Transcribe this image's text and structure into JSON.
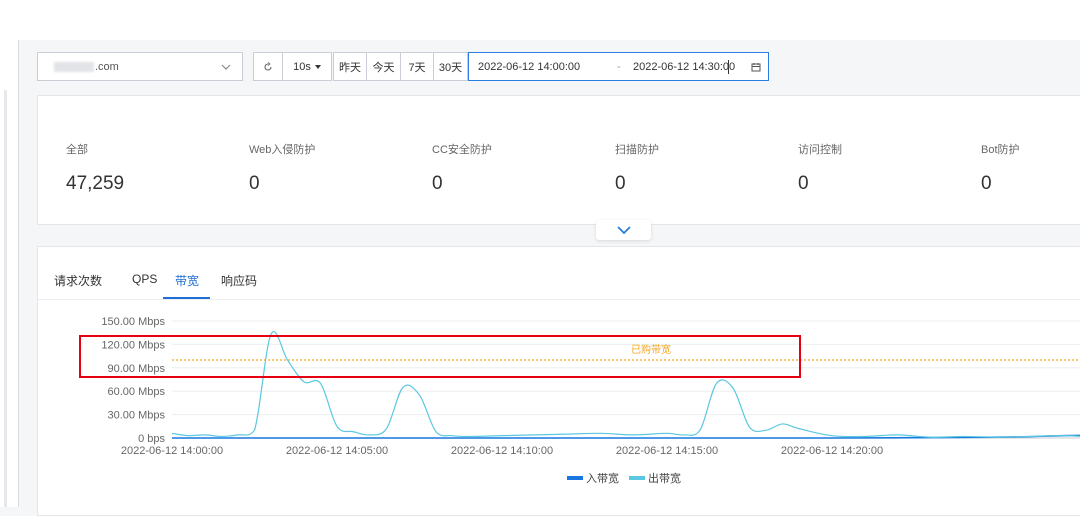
{
  "toolbar": {
    "domain_value": ".com",
    "refresh_interval": "10s",
    "ranges": [
      "昨天",
      "今天",
      "7天",
      "30天"
    ],
    "date_start": "2022-06-12 14:00:00",
    "date_separator": "-",
    "date_end": "2022-06-12 14:30:00"
  },
  "summary": {
    "stats": [
      {
        "label": "全部",
        "value": "47,259"
      },
      {
        "label": "Web入侵防护",
        "value": "0"
      },
      {
        "label": "CC安全防护",
        "value": "0"
      },
      {
        "label": "扫描防护",
        "value": "0"
      },
      {
        "label": "访问控制",
        "value": "0"
      },
      {
        "label": "Bot防护",
        "value": "0"
      }
    ]
  },
  "tabs": [
    "请求次数",
    "QPS",
    "带宽",
    "响应码"
  ],
  "active_tab": "带宽",
  "colors": {
    "accent": "#1f6fd4",
    "inbound": "#1677e0",
    "outbound": "#5bc8e0",
    "purchased_line": "#f5a623",
    "highlight_box": "#e60012"
  },
  "chart_data": {
    "type": "line",
    "y_ticks": [
      "150.00 Mbps",
      "120.00 Mbps",
      "90.00 Mbps",
      "60.00 Mbps",
      "30.00 Mbps",
      "0 bps"
    ],
    "ylim": [
      0,
      150
    ],
    "y_unit": "Mbps",
    "x_ticks": [
      "2022-06-12 14:00:00",
      "2022-06-12 14:05:00",
      "2022-06-12 14:10:00",
      "2022-06-12 14:15:00",
      "2022-06-12 14:20:00"
    ],
    "threshold": {
      "label": "已购带宽",
      "value": 100
    },
    "series": [
      {
        "name": "入带宽",
        "x": [
          "14:00:00",
          "14:02:00",
          "14:05:00",
          "14:10:00",
          "14:15:00",
          "14:20:00",
          "14:25:00",
          "14:27:00",
          "14:29:00",
          "14:30:00"
        ],
        "values": [
          0,
          0,
          0,
          0,
          0,
          0,
          1,
          3,
          4,
          2
        ]
      },
      {
        "name": "出带宽",
        "x": [
          "14:00:00",
          "14:00:30",
          "14:01:00",
          "14:01:30",
          "14:02:00",
          "14:02:30",
          "14:03:00",
          "14:03:30",
          "14:04:00",
          "14:04:30",
          "14:05:00",
          "14:05:30",
          "14:06:00",
          "14:06:30",
          "14:07:00",
          "14:07:30",
          "14:08:00",
          "14:08:30",
          "14:09:00",
          "14:10:00",
          "14:11:00",
          "14:12:00",
          "14:13:00",
          "14:14:00",
          "14:15:00",
          "14:15:30",
          "14:16:00",
          "14:16:30",
          "14:17:00",
          "14:17:30",
          "14:18:00",
          "14:18:30",
          "14:19:00",
          "14:20:00",
          "14:21:00",
          "14:22:00",
          "14:23:00",
          "14:24:00",
          "14:25:00",
          "14:26:00",
          "14:27:00",
          "14:28:00",
          "14:29:00",
          "14:29:30",
          "14:30:00"
        ],
        "values": [
          6,
          3,
          4,
          2,
          4,
          10,
          133,
          100,
          72,
          70,
          15,
          8,
          4,
          12,
          65,
          55,
          8,
          3,
          2,
          3,
          4,
          5,
          6,
          4,
          6,
          4,
          10,
          70,
          64,
          14,
          10,
          18,
          12,
          3,
          2,
          4,
          1,
          2,
          1,
          2,
          3,
          2,
          6,
          8,
          2
        ]
      }
    ],
    "legend_position": "bottom-center",
    "grid": true
  }
}
